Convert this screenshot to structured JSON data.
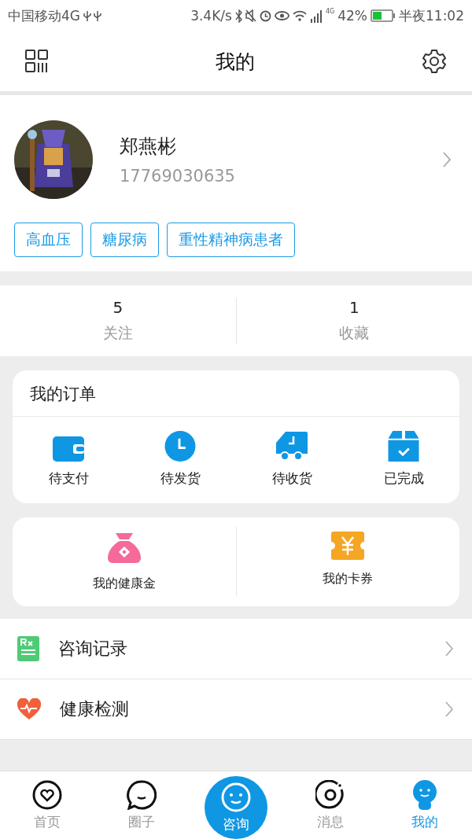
{
  "status_bar": {
    "carrier": "中国移动4G",
    "speed": "3.4K/s",
    "network": "4G",
    "battery": "42%",
    "time": "半夜11:02"
  },
  "header": {
    "title": "我的"
  },
  "profile": {
    "name": "郑燕彬",
    "phone": "17769030635"
  },
  "tags": [
    "高血压",
    "糖尿病",
    "重性精神病患者"
  ],
  "stats": [
    {
      "value": "5",
      "label": "关注"
    },
    {
      "value": "1",
      "label": "收藏"
    }
  ],
  "orders": {
    "title": "我的订单",
    "items": [
      {
        "kind": "wallet",
        "label": "待支付"
      },
      {
        "kind": "clock",
        "label": "待发货"
      },
      {
        "kind": "truck",
        "label": "待收货"
      },
      {
        "kind": "box",
        "label": "已完成"
      }
    ]
  },
  "wallet": [
    {
      "kind": "moneybag",
      "label": "我的健康金"
    },
    {
      "kind": "ticket",
      "label": "我的卡券"
    }
  ],
  "menu": [
    {
      "kind": "rx",
      "label": "咨询记录"
    },
    {
      "kind": "heart",
      "label": "健康检测"
    }
  ],
  "tab_bar": [
    {
      "kind": "home",
      "label": "首页",
      "selected": false
    },
    {
      "kind": "chat",
      "label": "圈子",
      "selected": false
    },
    {
      "kind": "consult",
      "label": "咨询",
      "selected": false
    },
    {
      "kind": "message",
      "label": "消息",
      "selected": false
    },
    {
      "kind": "me",
      "label": "我的",
      "selected": true
    }
  ]
}
